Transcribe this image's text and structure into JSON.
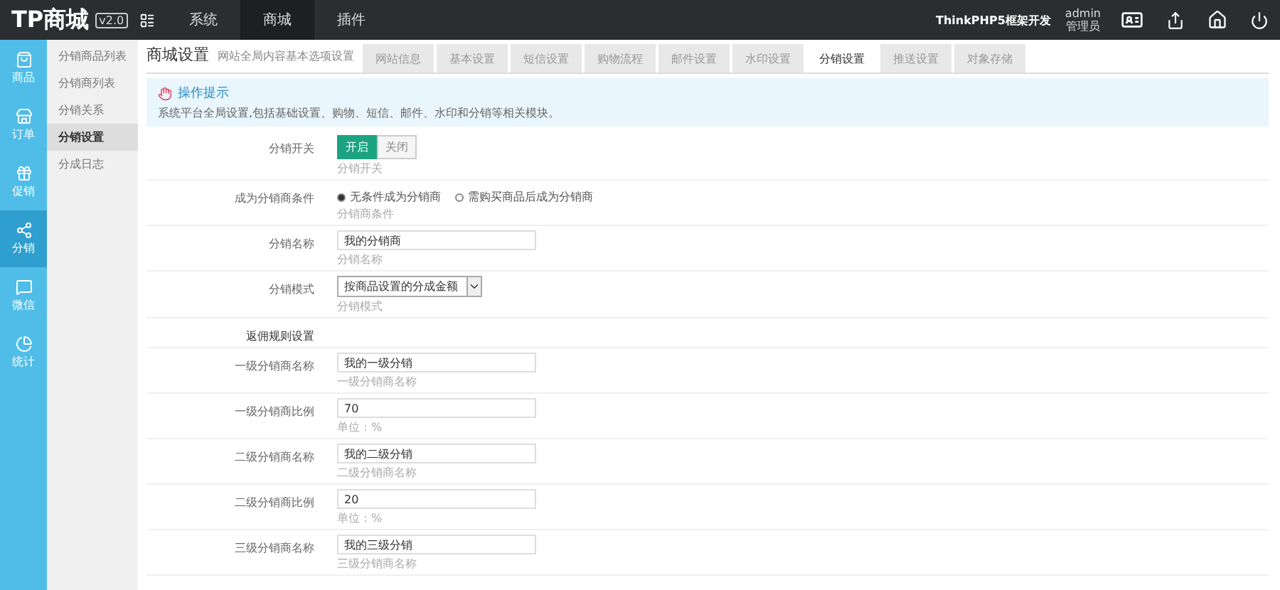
{
  "logo": {
    "name": "TP商城",
    "version": "v2.0"
  },
  "top_nav": [
    {
      "label": "系统",
      "selected": false
    },
    {
      "label": "商城",
      "selected": true
    },
    {
      "label": "插件",
      "selected": false
    }
  ],
  "top_right": {
    "framework": "ThinkPHP5框架开发",
    "user": "admin",
    "role": "管理员"
  },
  "icon_menu": [
    {
      "label": "商品",
      "selected": false
    },
    {
      "label": "订单",
      "selected": false
    },
    {
      "label": "促销",
      "selected": false
    },
    {
      "label": "分销",
      "selected": true
    },
    {
      "label": "微信",
      "selected": false
    },
    {
      "label": "统计",
      "selected": false
    }
  ],
  "sub_menu": [
    {
      "label": "分销商品列表",
      "selected": false
    },
    {
      "label": "分销商列表",
      "selected": false
    },
    {
      "label": "分销关系",
      "selected": false
    },
    {
      "label": "分销设置",
      "selected": true
    },
    {
      "label": "分成日志",
      "selected": false
    }
  ],
  "page_title": "商城设置",
  "page_subtitle": "网站全局内容基本选项设置",
  "tabs": [
    {
      "label": "网站信息",
      "selected": false
    },
    {
      "label": "基本设置",
      "selected": false
    },
    {
      "label": "短信设置",
      "selected": false
    },
    {
      "label": "购物流程",
      "selected": false
    },
    {
      "label": "邮件设置",
      "selected": false
    },
    {
      "label": "水印设置",
      "selected": false
    },
    {
      "label": "分销设置",
      "selected": true
    },
    {
      "label": "推送设置",
      "selected": false
    },
    {
      "label": "对象存储",
      "selected": false
    }
  ],
  "tip": {
    "title": "操作提示",
    "text": "系统平台全局设置,包括基础设置、购物、短信、邮件、水印和分销等相关模块。"
  },
  "form": [
    {
      "kind": "toggle",
      "label": "分销开关",
      "options": [
        {
          "label": "开启",
          "selected": true
        },
        {
          "label": "关闭",
          "selected": false
        }
      ],
      "hint": "分销开关"
    },
    {
      "kind": "radio",
      "label": "成为分销商条件",
      "options": [
        {
          "label": "无条件成为分销商",
          "selected": true
        },
        {
          "label": "需购买商品后成为分销商",
          "selected": false
        }
      ],
      "hint": "分销商条件"
    },
    {
      "kind": "text",
      "label": "分销名称",
      "value": "我的分销商",
      "hint": "分销名称"
    },
    {
      "kind": "select",
      "label": "分销模式",
      "value": "按商品设置的分成金额",
      "hint": "分销模式"
    },
    {
      "kind": "section",
      "label": "返佣规则设置"
    },
    {
      "kind": "text",
      "label": "一级分销商名称",
      "value": "我的一级分销",
      "hint": "一级分销商名称"
    },
    {
      "kind": "text",
      "label": "一级分销商比例",
      "value": "70",
      "hint": "单位：%"
    },
    {
      "kind": "text",
      "label": "二级分销商名称",
      "value": "我的二级分销",
      "hint": "二级分销商名称"
    },
    {
      "kind": "text",
      "label": "二级分销商比例",
      "value": "20",
      "hint": "单位：%"
    },
    {
      "kind": "text",
      "label": "三级分销商名称",
      "value": "我的三级分销",
      "hint": "三级分销商名称"
    }
  ]
}
